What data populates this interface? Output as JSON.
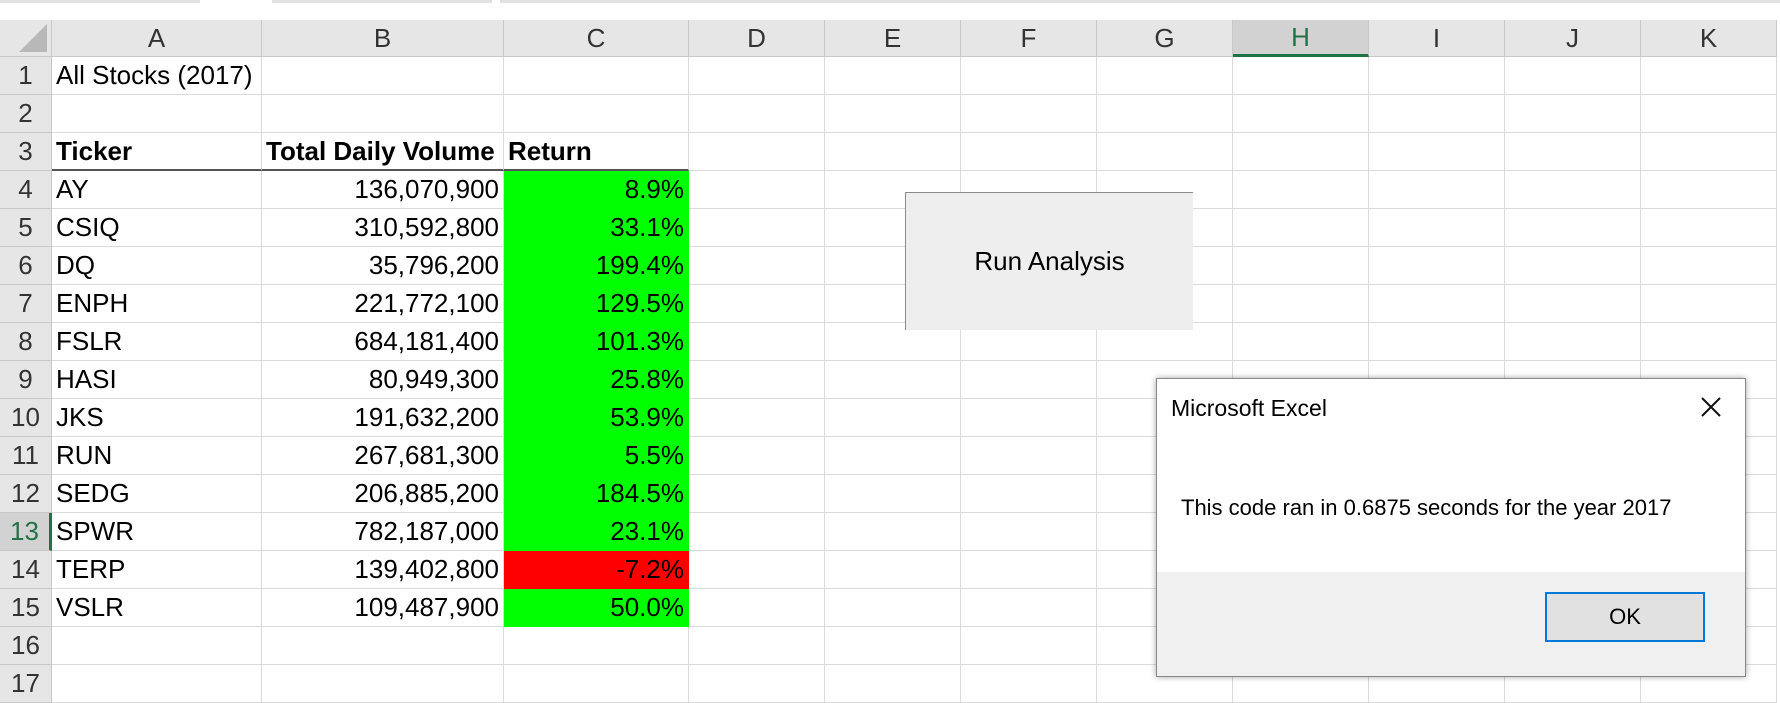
{
  "columns": [
    "A",
    "B",
    "C",
    "D",
    "E",
    "F",
    "G",
    "H",
    "I",
    "J",
    "K"
  ],
  "selected_column": "H",
  "rows": [
    "1",
    "2",
    "3",
    "4",
    "5",
    "6",
    "7",
    "8",
    "9",
    "10",
    "11",
    "12",
    "13",
    "14",
    "15",
    "16",
    "17"
  ],
  "selected_row": "13",
  "sheet": {
    "title": "All Stocks (2017)",
    "headers": {
      "ticker": "Ticker",
      "volume": "Total Daily Volume",
      "return": "Return"
    },
    "data": [
      {
        "ticker": "AY",
        "volume": "136,070,900",
        "return": "8.9%",
        "status": "positive"
      },
      {
        "ticker": "CSIQ",
        "volume": "310,592,800",
        "return": "33.1%",
        "status": "positive"
      },
      {
        "ticker": "DQ",
        "volume": "35,796,200",
        "return": "199.4%",
        "status": "positive"
      },
      {
        "ticker": "ENPH",
        "volume": "221,772,100",
        "return": "129.5%",
        "status": "positive"
      },
      {
        "ticker": "FSLR",
        "volume": "684,181,400",
        "return": "101.3%",
        "status": "positive"
      },
      {
        "ticker": "HASI",
        "volume": "80,949,300",
        "return": "25.8%",
        "status": "positive"
      },
      {
        "ticker": "JKS",
        "volume": "191,632,200",
        "return": "53.9%",
        "status": "positive"
      },
      {
        "ticker": "RUN",
        "volume": "267,681,300",
        "return": "5.5%",
        "status": "positive"
      },
      {
        "ticker": "SEDG",
        "volume": "206,885,200",
        "return": "184.5%",
        "status": "positive"
      },
      {
        "ticker": "SPWR",
        "volume": "782,187,000",
        "return": "23.1%",
        "status": "positive"
      },
      {
        "ticker": "TERP",
        "volume": "139,402,800",
        "return": "-7.2%",
        "status": "negative"
      },
      {
        "ticker": "VSLR",
        "volume": "109,487,900",
        "return": "50.0%",
        "status": "positive"
      }
    ]
  },
  "run_button": {
    "label": "Run Analysis"
  },
  "dialog": {
    "title": "Microsoft Excel",
    "message": "This code ran in 0.6875 seconds for the year 2017",
    "ok_label": "OK",
    "close_icon": "close-icon"
  },
  "colors": {
    "positive": "#00ff00",
    "negative": "#ff0000",
    "accent": "#217346",
    "ok_border": "#0078d7"
  }
}
